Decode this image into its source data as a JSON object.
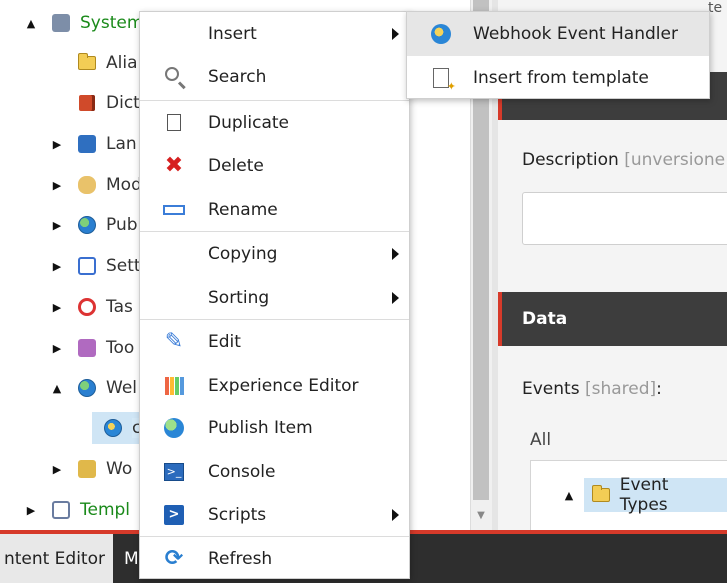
{
  "tree": {
    "items": [
      {
        "label": "System",
        "icon": "system-icon",
        "expand": "▲",
        "green": true
      },
      {
        "label": "Alia",
        "icon": "folder-icon",
        "expand": ""
      },
      {
        "label": "Dict",
        "icon": "dictionary-icon",
        "expand": ""
      },
      {
        "label": "Lan",
        "icon": "languages-icon",
        "expand": "▶"
      },
      {
        "label": "Mod",
        "icon": "modules-icon",
        "expand": "▶"
      },
      {
        "label": "Pub",
        "icon": "publishing-icon",
        "expand": "▶"
      },
      {
        "label": "Sett",
        "icon": "settings-icon",
        "expand": "▶"
      },
      {
        "label": "Tas",
        "icon": "tasks-icon",
        "expand": "▶"
      },
      {
        "label": "Too",
        "icon": "toolbox-icon",
        "expand": "▶"
      },
      {
        "label": "Wel",
        "icon": "globe-icon",
        "expand": "▲"
      },
      {
        "label": "c",
        "icon": "webhook-icon",
        "expand": ""
      },
      {
        "label": "Wo",
        "icon": "workflows-icon",
        "expand": "▶"
      },
      {
        "label": "Templ",
        "icon": "templates-icon",
        "expand": "▶",
        "green": true
      }
    ]
  },
  "context_menu": {
    "items": [
      {
        "label": "Insert",
        "icon": "",
        "submenu": true
      },
      {
        "label": "Search",
        "icon": "search-icon",
        "submenu": false
      },
      {
        "label": "Duplicate",
        "icon": "duplicate-icon",
        "submenu": false
      },
      {
        "label": "Delete",
        "icon": "delete-icon",
        "submenu": false
      },
      {
        "label": "Rename",
        "icon": "rename-icon",
        "submenu": false
      },
      {
        "label": "Copying",
        "icon": "",
        "submenu": true
      },
      {
        "label": "Sorting",
        "icon": "",
        "submenu": true
      },
      {
        "label": "Edit",
        "icon": "edit-icon",
        "submenu": false
      },
      {
        "label": "Experience Editor",
        "icon": "experience-editor-icon",
        "submenu": false
      },
      {
        "label": "Publish Item",
        "icon": "publish-icon",
        "submenu": false
      },
      {
        "label": "Console",
        "icon": "console-icon",
        "submenu": false
      },
      {
        "label": "Scripts",
        "icon": "scripts-icon",
        "submenu": true
      },
      {
        "label": "Refresh",
        "icon": "refresh-icon",
        "submenu": false
      }
    ]
  },
  "insert_submenu": {
    "items": [
      {
        "label": "Webhook Event Handler",
        "icon": "webhook-icon"
      },
      {
        "label": "Insert from template",
        "icon": "template-icon"
      }
    ]
  },
  "content": {
    "top_fragment": "te",
    "description_label": "Description",
    "description_tag": "[unversione",
    "data_header": "Data",
    "events_label": "Events",
    "events_tag": "[shared]",
    "events_colon": ":",
    "all_label": "All",
    "event_types": "Event Types"
  },
  "bottom": {
    "content_editor_tab": "ntent Editor",
    "second_tab": "M"
  },
  "colors": {
    "accent_red": "#d63a2a",
    "tree_green": "#1a8a1a",
    "selection_blue": "#cfe5f5"
  }
}
